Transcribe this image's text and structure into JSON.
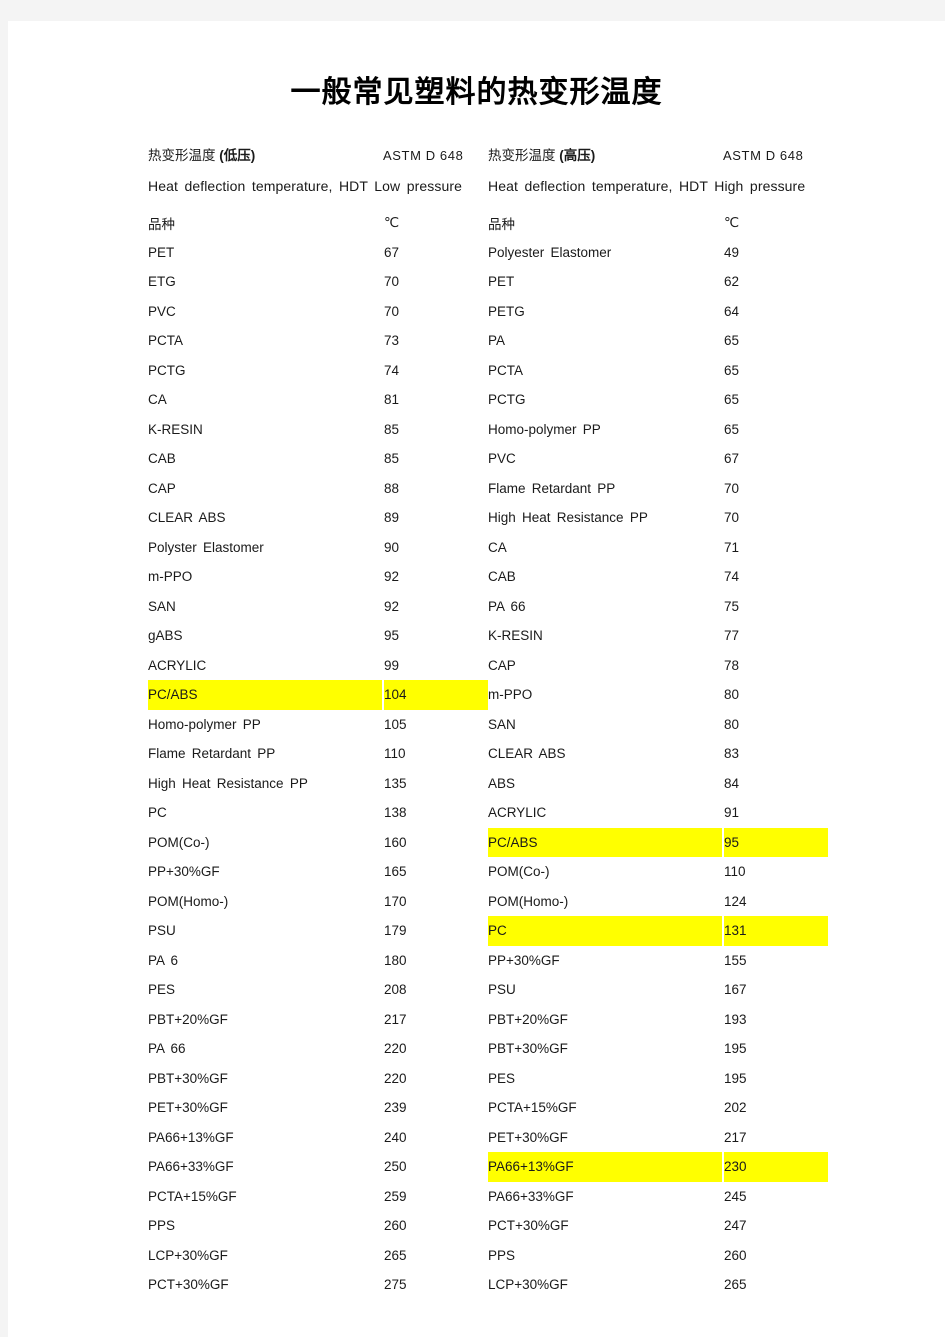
{
  "document": {
    "title": "一般常见塑料的热变形温度"
  },
  "left_section": {
    "label_main": "热变形温度",
    "label_paren": "(低压)",
    "standard": "ASTM D 648",
    "english": "Heat deflection temperature, HDT Low pressure",
    "header_name": "品种",
    "header_unit": "℃",
    "rows": [
      {
        "name": "PET",
        "value": "67",
        "highlight": false
      },
      {
        "name": "ETG",
        "value": "70",
        "highlight": false
      },
      {
        "name": "PVC",
        "value": "70",
        "highlight": false
      },
      {
        "name": "PCTA",
        "value": "73",
        "highlight": false
      },
      {
        "name": "PCTG",
        "value": "74",
        "highlight": false
      },
      {
        "name": "CA",
        "value": "81",
        "highlight": false
      },
      {
        "name": "K-RESIN",
        "value": "85",
        "highlight": false
      },
      {
        "name": "CAB",
        "value": "85",
        "highlight": false
      },
      {
        "name": "CAP",
        "value": "88",
        "highlight": false
      },
      {
        "name": "CLEAR ABS",
        "value": "89",
        "highlight": false
      },
      {
        "name": "Polyster Elastomer",
        "value": "90",
        "highlight": false
      },
      {
        "name": "m-PPO",
        "value": "92",
        "highlight": false
      },
      {
        "name": "SAN",
        "value": "92",
        "highlight": false
      },
      {
        "name": "gABS",
        "value": "95",
        "highlight": false
      },
      {
        "name": "ACRYLIC",
        "value": "99",
        "highlight": false
      },
      {
        "name": "PC/ABS",
        "value": "104",
        "highlight": true
      },
      {
        "name": "Homo-polymer PP",
        "value": "105",
        "highlight": false
      },
      {
        "name": "Flame Retardant PP",
        "value": "110",
        "highlight": false
      },
      {
        "name": "High Heat Resistance PP",
        "value": "135",
        "highlight": false
      },
      {
        "name": "PC",
        "value": "138",
        "highlight": false
      },
      {
        "name": "POM(Co-)",
        "value": "160",
        "highlight": false
      },
      {
        "name": "PP+30%GF",
        "value": "165",
        "highlight": false
      },
      {
        "name": "POM(Homo-)",
        "value": "170",
        "highlight": false
      },
      {
        "name": "PSU",
        "value": "179",
        "highlight": false
      },
      {
        "name": "PA 6",
        "value": "180",
        "highlight": false
      },
      {
        "name": "PES",
        "value": "208",
        "highlight": false
      },
      {
        "name": "PBT+20%GF",
        "value": "217",
        "highlight": false
      },
      {
        "name": "PA 66",
        "value": "220",
        "highlight": false
      },
      {
        "name": "PBT+30%GF",
        "value": "220",
        "highlight": false
      },
      {
        "name": "PET+30%GF",
        "value": "239",
        "highlight": false
      },
      {
        "name": "PA66+13%GF",
        "value": "240",
        "highlight": false
      },
      {
        "name": "PA66+33%GF",
        "value": "250",
        "highlight": false
      },
      {
        "name": "PCTA+15%GF",
        "value": "259",
        "highlight": false
      },
      {
        "name": "PPS",
        "value": "260",
        "highlight": false
      },
      {
        "name": "LCP+30%GF",
        "value": "265",
        "highlight": false
      },
      {
        "name": "PCT+30%GF",
        "value": "275",
        "highlight": false
      }
    ]
  },
  "right_section": {
    "label_main": "热变形温度",
    "label_paren": "(高压)",
    "standard": "ASTM D 648",
    "english": "Heat deflection temperature, HDT High pressure",
    "header_name": "品种",
    "header_unit": "℃",
    "rows": [
      {
        "name": "Polyester Elastomer",
        "value": "49",
        "highlight": false
      },
      {
        "name": "PET",
        "value": "62",
        "highlight": false
      },
      {
        "name": "PETG",
        "value": "64",
        "highlight": false
      },
      {
        "name": "PA",
        "value": "65",
        "highlight": false
      },
      {
        "name": "PCTA",
        "value": "65",
        "highlight": false
      },
      {
        "name": "PCTG",
        "value": "65",
        "highlight": false
      },
      {
        "name": "Homo-polymer PP",
        "value": "65",
        "highlight": false
      },
      {
        "name": "PVC",
        "value": "67",
        "highlight": false
      },
      {
        "name": "Flame Retardant PP",
        "value": "70",
        "highlight": false
      },
      {
        "name": "High Heat Resistance PP",
        "value": "70",
        "highlight": false
      },
      {
        "name": "CA",
        "value": "71",
        "highlight": false
      },
      {
        "name": "CAB",
        "value": "74",
        "highlight": false
      },
      {
        "name": "PA 66",
        "value": "75",
        "highlight": false
      },
      {
        "name": "K-RESIN",
        "value": "77",
        "highlight": false
      },
      {
        "name": "CAP",
        "value": "78",
        "highlight": false
      },
      {
        "name": "m-PPO",
        "value": "80",
        "highlight": false
      },
      {
        "name": "SAN",
        "value": "80",
        "highlight": false
      },
      {
        "name": "CLEAR ABS",
        "value": "83",
        "highlight": false
      },
      {
        "name": "ABS",
        "value": "84",
        "highlight": false
      },
      {
        "name": "ACRYLIC",
        "value": "91",
        "highlight": false
      },
      {
        "name": "PC/ABS",
        "value": "95",
        "highlight": true
      },
      {
        "name": "POM(Co-)",
        "value": "110",
        "highlight": false
      },
      {
        "name": "POM(Homo-)",
        "value": "124",
        "highlight": false
      },
      {
        "name": "PC",
        "value": "131",
        "highlight": true
      },
      {
        "name": "PP+30%GF",
        "value": "155",
        "highlight": false
      },
      {
        "name": "PSU",
        "value": "167",
        "highlight": false
      },
      {
        "name": "PBT+20%GF",
        "value": "193",
        "highlight": false
      },
      {
        "name": "PBT+30%GF",
        "value": "195",
        "highlight": false
      },
      {
        "name": "PES",
        "value": "195",
        "highlight": false
      },
      {
        "name": "PCTA+15%GF",
        "value": "202",
        "highlight": false
      },
      {
        "name": "PET+30%GF",
        "value": "217",
        "highlight": false
      },
      {
        "name": "PA66+13%GF",
        "value": "230",
        "highlight": true
      },
      {
        "name": "PA66+33%GF",
        "value": "245",
        "highlight": false
      },
      {
        "name": "PCT+30%GF",
        "value": "247",
        "highlight": false
      },
      {
        "name": "PPS",
        "value": "260",
        "highlight": false
      },
      {
        "name": "LCP+30%GF",
        "value": "265",
        "highlight": false
      }
    ]
  },
  "colors": {
    "highlight": "#ffff00",
    "text": "#1a1a1a",
    "page": "#ffffff",
    "margin": "#f4f4f4"
  }
}
